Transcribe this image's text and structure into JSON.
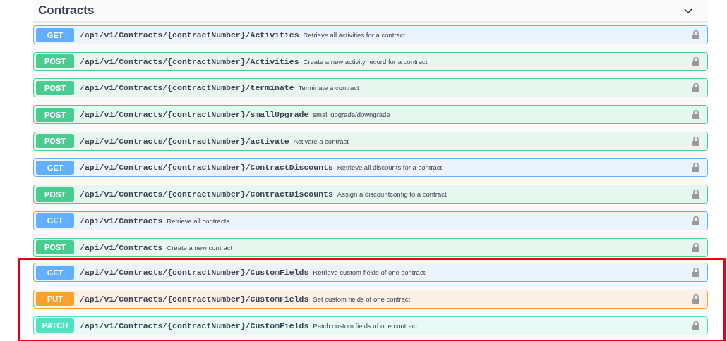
{
  "section": {
    "title": "Contracts",
    "expanded": true
  },
  "operations": [
    {
      "kind": "get",
      "method": "GET",
      "path": "/api/v1/Contracts/{contractNumber}/Activities",
      "summary": "Retrieve all activities for a contract",
      "highlighted": false
    },
    {
      "kind": "post",
      "method": "POST",
      "path": "/api/v1/Contracts/{contractNumber}/Activities",
      "summary": "Create a new activity record for a contract",
      "highlighted": false
    },
    {
      "kind": "post",
      "method": "POST",
      "path": "/api/v1/Contracts/{contractNumber}/terminate",
      "summary": "Terminate a contract",
      "highlighted": false
    },
    {
      "kind": "post",
      "method": "POST",
      "path": "/api/v1/Contracts/{contractNumber}/smallUpgrade",
      "summary": "small upgrade/downgrade",
      "highlighted": false
    },
    {
      "kind": "post",
      "method": "POST",
      "path": "/api/v1/Contracts/{contractNumber}/activate",
      "summary": "Activate a contract",
      "highlighted": false
    },
    {
      "kind": "get",
      "method": "GET",
      "path": "/api/v1/Contracts/{contractNumber}/ContractDiscounts",
      "summary": "Retrieve all discounts for a contract",
      "highlighted": false
    },
    {
      "kind": "post",
      "method": "POST",
      "path": "/api/v1/Contracts/{contractNumber}/ContractDiscounts",
      "summary": "Assign a discountconfig to a contract",
      "highlighted": false
    },
    {
      "kind": "get",
      "method": "GET",
      "path": "/api/v1/Contracts",
      "summary": "Retrieve all contracts",
      "highlighted": false
    },
    {
      "kind": "post",
      "method": "POST",
      "path": "/api/v1/Contracts",
      "summary": "Create a new contract",
      "highlighted": false
    },
    {
      "kind": "get",
      "method": "GET",
      "path": "/api/v1/Contracts/{contractNumber}/CustomFields",
      "summary": "Retrieve custom fields of one contract",
      "highlighted": true
    },
    {
      "kind": "put",
      "method": "PUT",
      "path": "/api/v1/Contracts/{contractNumber}/CustomFields",
      "summary": "Set custom fields of one contract",
      "highlighted": true
    },
    {
      "kind": "patch",
      "method": "PATCH",
      "path": "/api/v1/Contracts/{contractNumber}/CustomFields",
      "summary": "Patch custom fields of one contract",
      "highlighted": true
    }
  ]
}
